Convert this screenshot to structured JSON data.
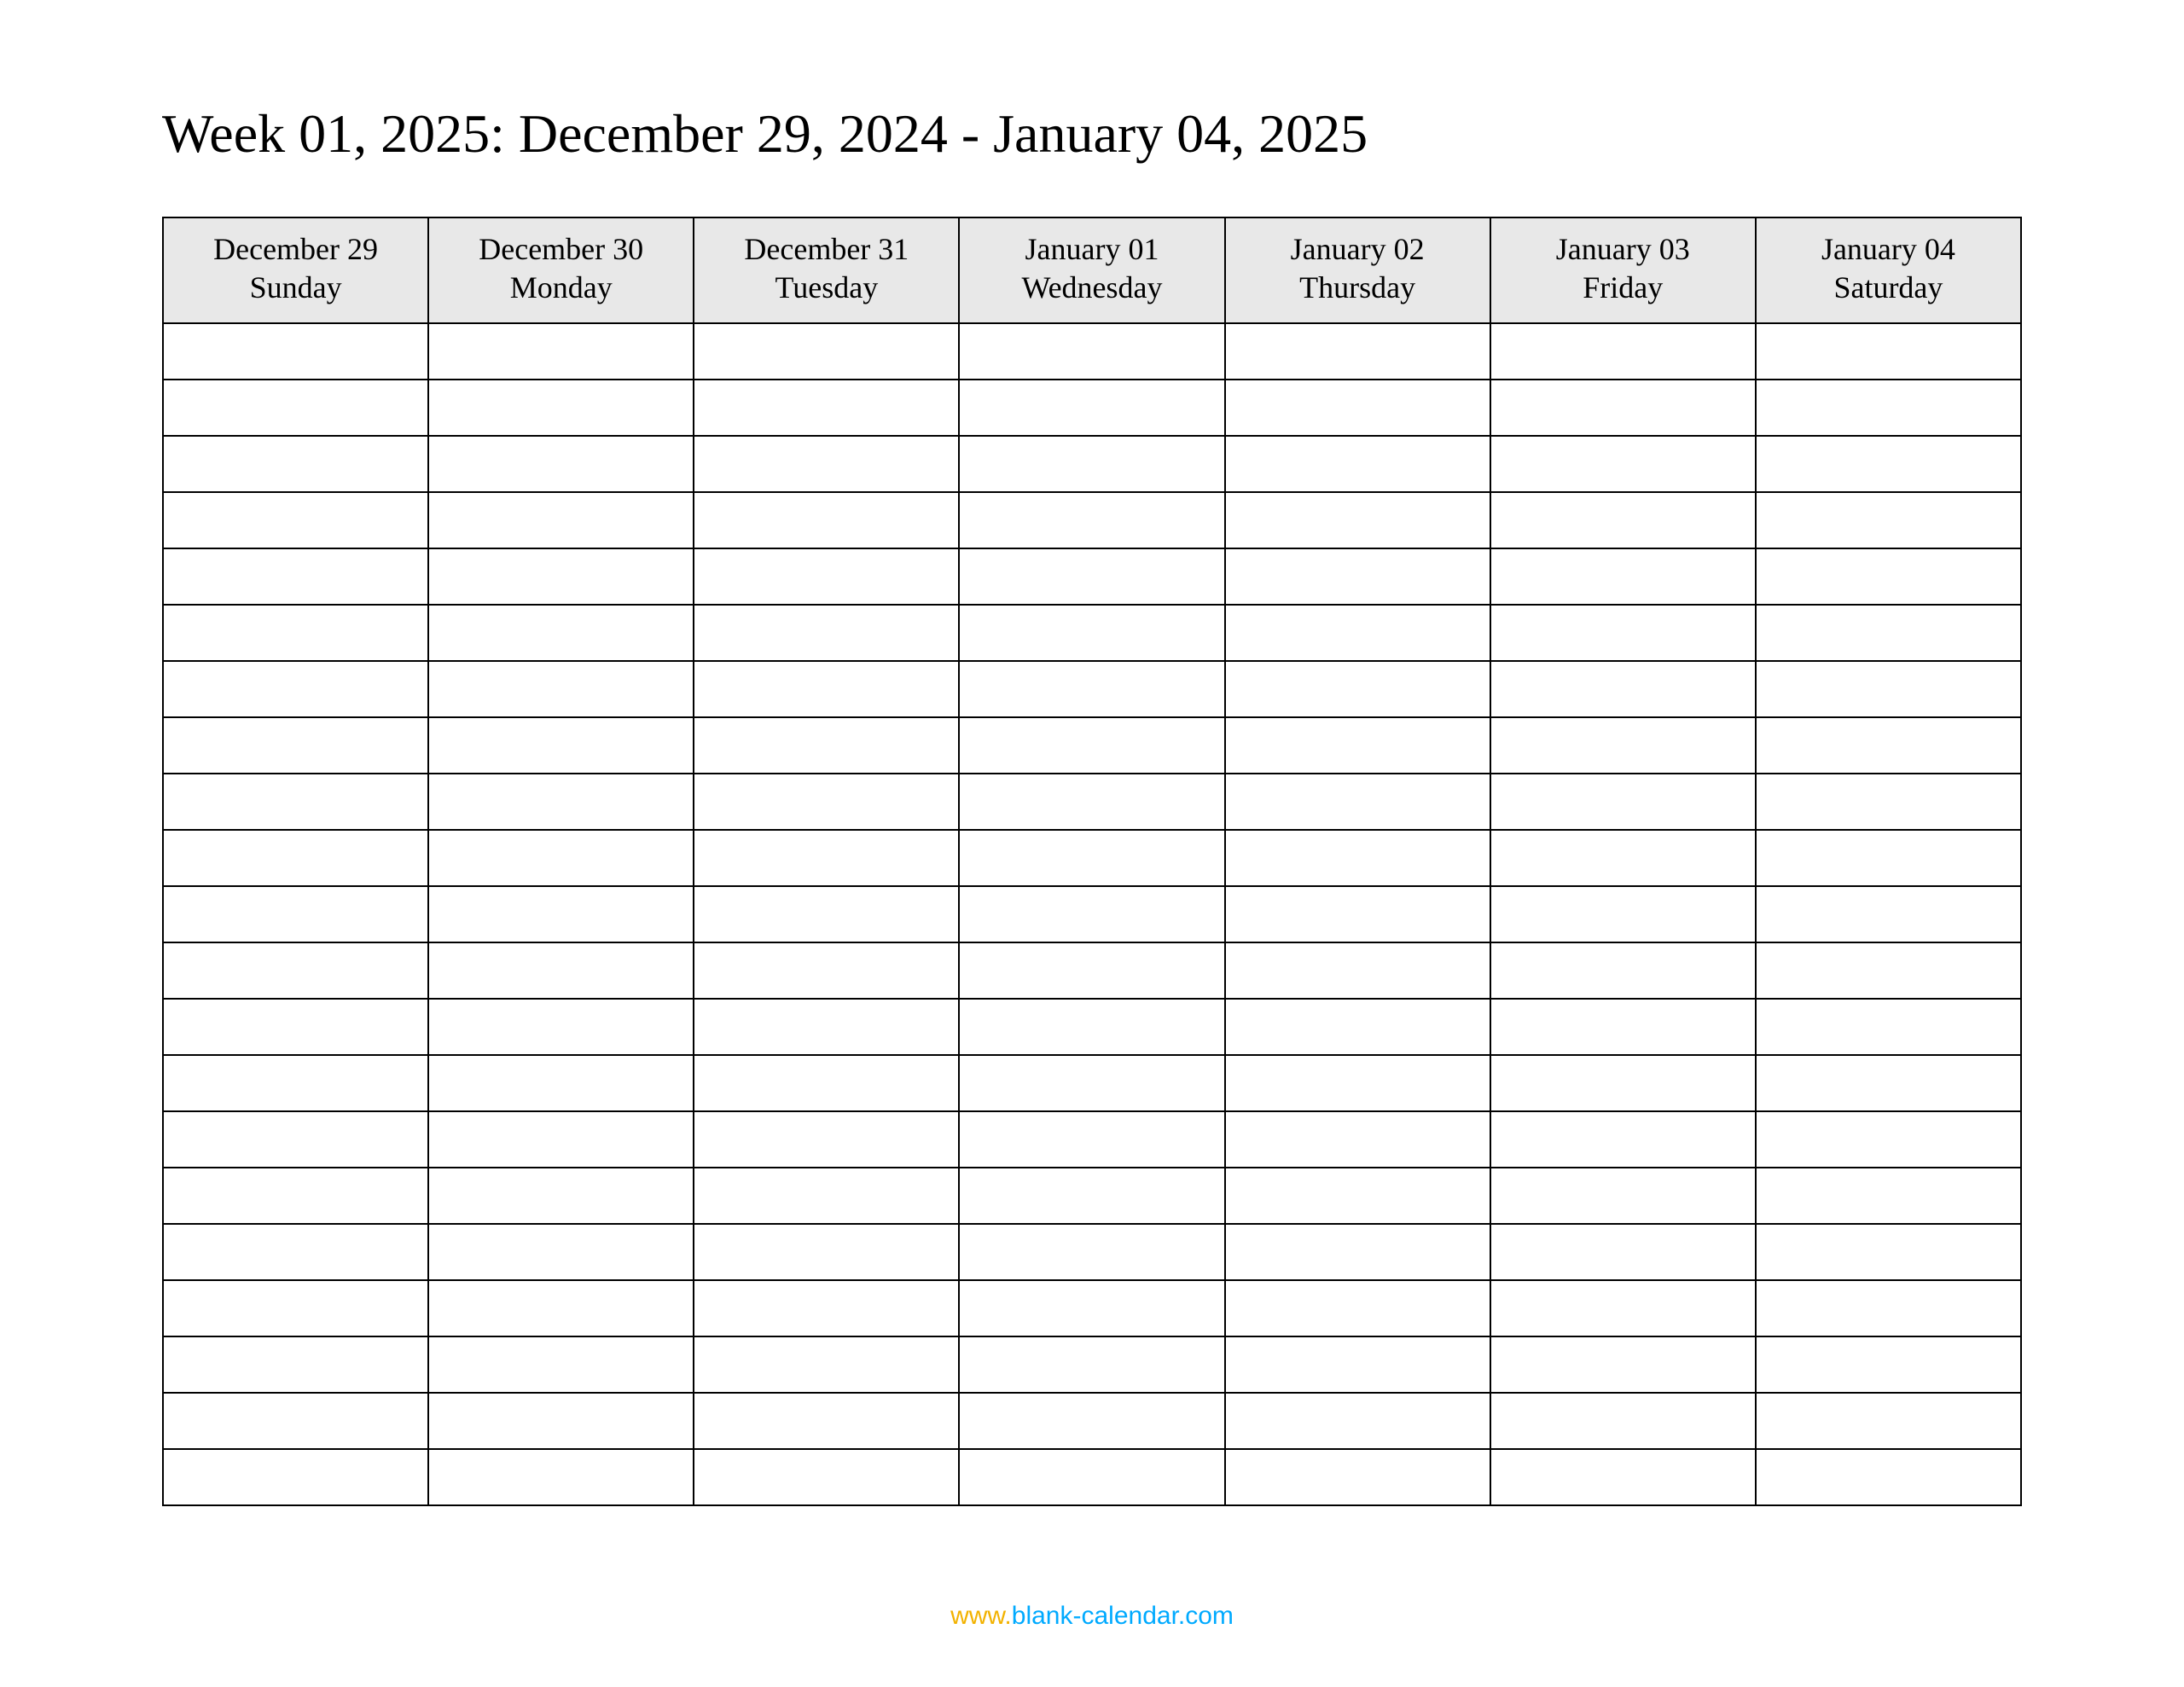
{
  "title": "Week 01, 2025: December 29, 2024 - January 04, 2025",
  "columns": [
    {
      "date": "December 29",
      "dow": "Sunday"
    },
    {
      "date": "December 30",
      "dow": "Monday"
    },
    {
      "date": "December 31",
      "dow": "Tuesday"
    },
    {
      "date": "January 01",
      "dow": "Wednesday"
    },
    {
      "date": "January 02",
      "dow": "Thursday"
    },
    {
      "date": "January 03",
      "dow": "Friday"
    },
    {
      "date": "January 04",
      "dow": "Saturday"
    }
  ],
  "blank_rows": 21,
  "footer": {
    "www": "www.",
    "rest": "blank-calendar.com"
  }
}
